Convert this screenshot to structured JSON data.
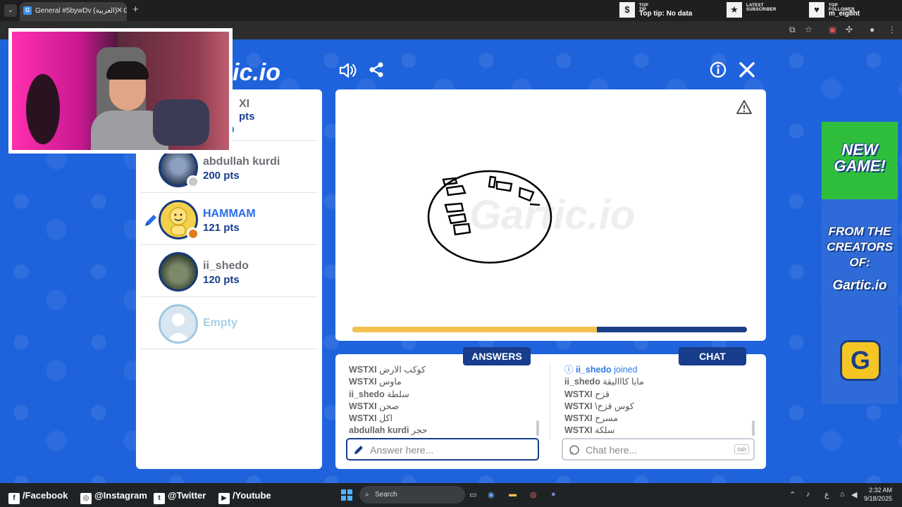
{
  "browser": {
    "tab_title": "General #5bywDv (العربية) - Ga",
    "tab_close": "✕",
    "new_tab": "+"
  },
  "stream_overlay": {
    "top_tip": {
      "label": "TOP TIP",
      "value": "Top tip: No data"
    },
    "latest_subscriber": {
      "label": "LATEST SUBSCRIBER",
      "value": ""
    },
    "top_follower": {
      "label": "TOP FOLLOWER",
      "value": "m_eig8ht"
    }
  },
  "game": {
    "logo": "ic.io",
    "players": [
      {
        "name": "XI",
        "points": "pts",
        "status_color": "#2a6de6"
      },
      {
        "name": "abdullah kurdi",
        "points": "200 pts",
        "status_color": "#c8c8c8"
      },
      {
        "name": "HAMMAM",
        "points": "121 pts",
        "status_color": "#e07b1a",
        "drawing": true
      },
      {
        "name": "ii_shedo",
        "points": "120 pts",
        "status_color": null
      },
      {
        "name": "Empty",
        "points": "",
        "status_color": null
      }
    ],
    "progress": 0.62,
    "tabs": {
      "answers": "ANSWERS",
      "chat": "CHAT"
    },
    "answers": [
      {
        "user": "WSTXI",
        "text": "كوكب الارض"
      },
      {
        "user": "WSTXI",
        "text": "ماوس"
      },
      {
        "user": "ii_shedo",
        "text": "سلطة"
      },
      {
        "user": "WSTXI",
        "text": "صحن"
      },
      {
        "user": "WSTXI",
        "text": "اكل"
      },
      {
        "user": "abdullah kurdi",
        "text": "حجر"
      }
    ],
    "chat": [
      {
        "user": "ii_shedo",
        "text": "joined",
        "system": true
      },
      {
        "user": "ii_shedo",
        "text": "مايا كاااليقة"
      },
      {
        "user": "WSTXI",
        "text": "قزح"
      },
      {
        "user": "WSTXI",
        "text": "\\كوس قزح"
      },
      {
        "user": "WSTXI",
        "text": "مسرح"
      },
      {
        "user": "WSTXI",
        "text": "سلكة"
      }
    ],
    "answer_placeholder": "Answer here...",
    "chat_placeholder": "Chat here...",
    "chat_key_hint": "tab"
  },
  "ad": {
    "headline": "NEW GAME!",
    "line1": "FROM THE",
    "line2": "CREATORS",
    "line3": "OF:",
    "brand": "Gartic.io"
  },
  "taskbar": {
    "facebook": "/Facebook",
    "instagram": "@Instagram",
    "twitter": "@Twitter",
    "youtube": "/Youtube",
    "search": "Search",
    "time": "2:32 AM",
    "date": "9/18/2025",
    "lang": "ع"
  },
  "colors": {
    "game_blue": "#1f63dc",
    "navy": "#173d8c",
    "progress_yellow": "#f2c14e",
    "link_blue": "#2a6de6"
  }
}
